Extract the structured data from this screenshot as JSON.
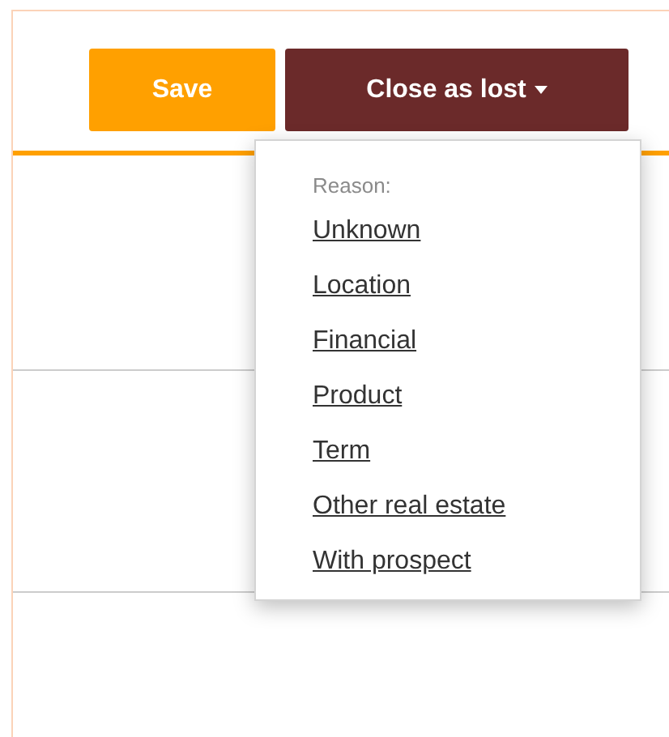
{
  "toolbar": {
    "save_button": "Save",
    "close_button": {
      "label": "Close as lost",
      "expanded": true
    }
  },
  "reason_menu": {
    "heading": "Reason:",
    "items": [
      "Unknown",
      "Location",
      "Financial",
      "Product",
      "Term",
      "Other real estate",
      "With prospect"
    ]
  }
}
